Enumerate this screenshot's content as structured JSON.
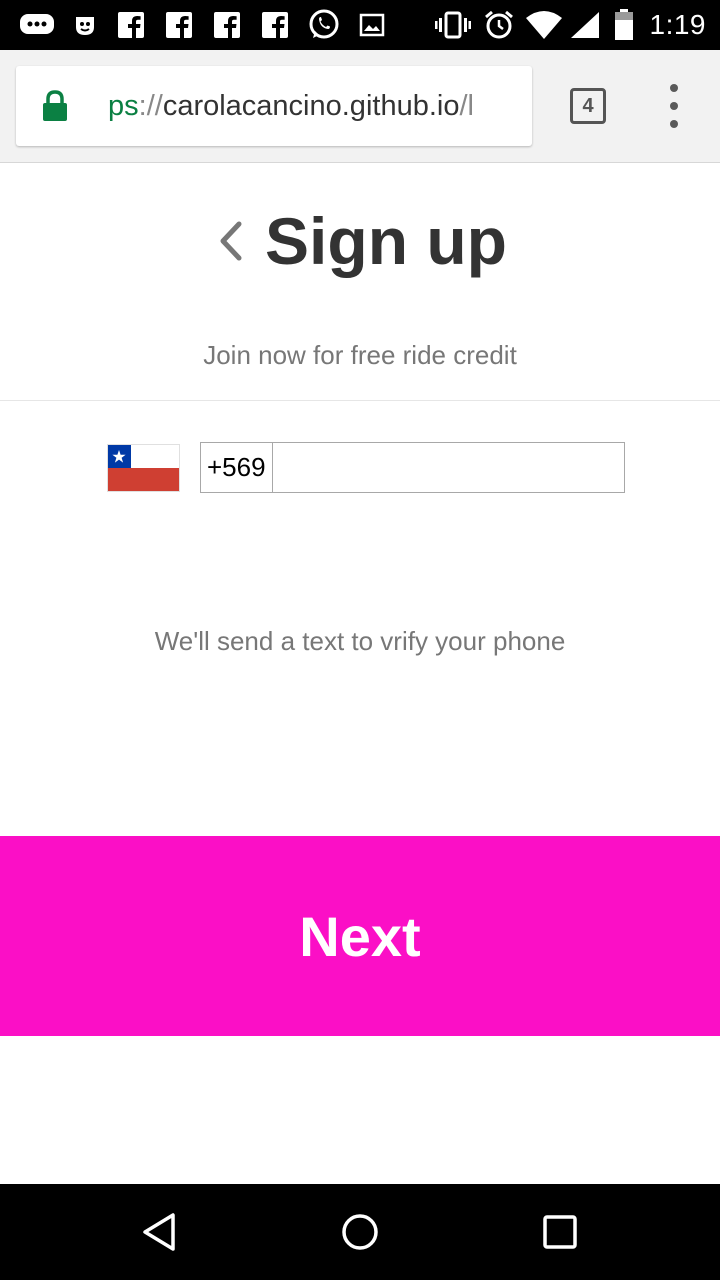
{
  "status_bar": {
    "time": "1:19",
    "left_icons": [
      "chat-bubble-icon",
      "face-icon",
      "facebook-icon",
      "facebook-icon",
      "facebook-icon",
      "facebook-icon",
      "whatsapp-icon",
      "image-icon"
    ],
    "right_icons": [
      "vibrate-icon",
      "alarm-icon",
      "wifi-icon",
      "signal-icon",
      "battery-icon"
    ]
  },
  "browser": {
    "url_scheme": "ps",
    "url_separator": "://",
    "url_host": "carolacancino.github.io",
    "url_tail": "/l",
    "tab_count": "4"
  },
  "page": {
    "title": "Sign up",
    "subtitle": "Join now for free ride credit",
    "country_flag": "chile-flag-icon",
    "phone_prefix": "+569",
    "phone_value": "",
    "info_text": "We'll send a text to vrify your phone",
    "next_label": "Next"
  },
  "colors": {
    "accent": "#fb0fc6",
    "title_text": "#333333",
    "muted_text": "#777777",
    "secure_green": "#0b8043",
    "flag_blue": "#0039a6",
    "flag_red": "#d52b1e"
  }
}
